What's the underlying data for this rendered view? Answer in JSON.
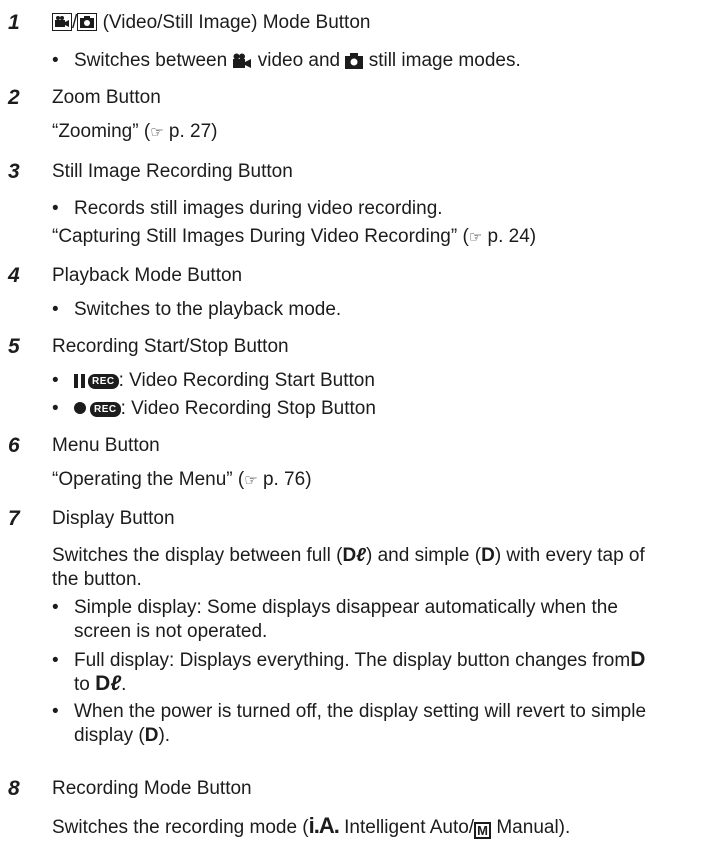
{
  "items": [
    {
      "num": "1",
      "title": "(Video/Still Image) Mode Button",
      "bullet_pre": "Switches between",
      "bullet_mid": "video and",
      "bullet_post": "still image modes."
    },
    {
      "num": "2",
      "title": "Zoom Button",
      "ref_text": "“Zooming” (",
      "ref_page": "p. 27)"
    },
    {
      "num": "3",
      "title": "Still Image Recording Button",
      "bullet": "Records still images during video recording.",
      "ref_text": "“Capturing Still Images During Video Recording” (",
      "ref_page": "p. 24)"
    },
    {
      "num": "4",
      "title": "Playback Mode Button",
      "bullet": "Switches to the playback mode."
    },
    {
      "num": "5",
      "title": "Recording Start/Stop Button",
      "bullet1": ": Video Recording Start Button",
      "bullet2": ": Video Recording Stop Button",
      "rec_label": "REC"
    },
    {
      "num": "6",
      "title": "Menu Button",
      "ref_text": "“Operating the Menu” (",
      "ref_page": "p. 76)"
    },
    {
      "num": "7",
      "title": "Display Button",
      "desc1_pre": "Switches the display between full (",
      "desc1_mid": ") and simple (",
      "desc1_post": ") with every tap of",
      "desc2": "the button.",
      "b1_line1": "Simple display: Some displays disappear automatically when the",
      "b1_line2": "screen is not operated.",
      "b2_line1": "Full display: Displays everything. The display button changes from",
      "b2_line2_pre": "to",
      "b3_line1": "When the power is turned off, the display setting will revert to simple",
      "b3_line2_pre": "display (",
      "b3_line2_post": ")."
    },
    {
      "num": "8",
      "title": "Recording Mode Button",
      "desc_pre": "Switches the recording mode (",
      "ia": "i.A.",
      "desc_mid": "Intelligent Auto/",
      "desc_post": "Manual).",
      "m_label": "M"
    }
  ],
  "symbols": {
    "bullet": "•",
    "hand": "☞",
    "D": "D",
    "Dfull": "D",
    "bold_d": "D",
    "dot": "."
  }
}
